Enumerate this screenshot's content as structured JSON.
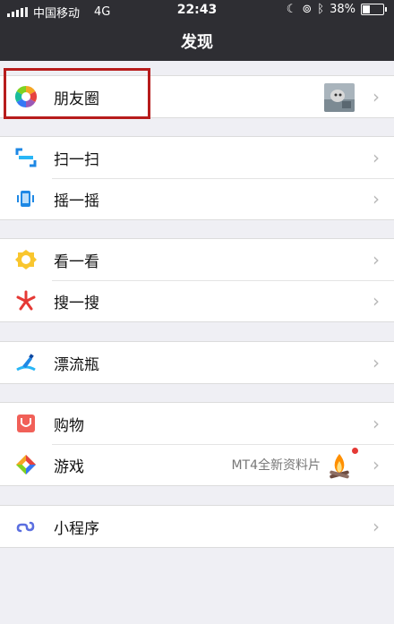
{
  "status_bar": {
    "carrier": "中国移动",
    "network": "4G",
    "time": "22:43",
    "battery": "38%"
  },
  "nav": {
    "title": "发现"
  },
  "groups": [
    {
      "items": [
        {
          "label": "朋友圈",
          "icon": "moments-icon"
        }
      ]
    },
    {
      "items": [
        {
          "label": "扫一扫",
          "icon": "scan-icon"
        },
        {
          "label": "摇一摇",
          "icon": "shake-icon"
        }
      ]
    },
    {
      "items": [
        {
          "label": "看一看",
          "icon": "top-stories-icon"
        },
        {
          "label": "搜一搜",
          "icon": "search-icon"
        }
      ]
    },
    {
      "items": [
        {
          "label": "漂流瓶",
          "icon": "bottle-icon"
        }
      ]
    },
    {
      "items": [
        {
          "label": "购物",
          "icon": "shopping-icon"
        },
        {
          "label": "游戏",
          "icon": "game-icon",
          "note": "MT4全新资料片"
        }
      ]
    },
    {
      "items": [
        {
          "label": "小程序",
          "icon": "mini-program-icon"
        }
      ]
    }
  ],
  "colors": {
    "bar": "#2e2e33",
    "highlight": "#b71c1c",
    "background": "#efeff4"
  }
}
